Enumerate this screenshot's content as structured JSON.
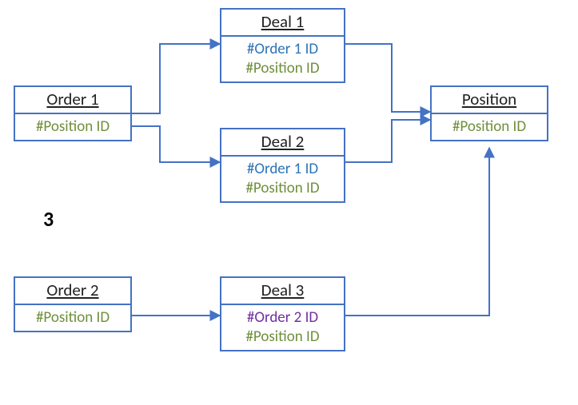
{
  "labels": {
    "sideB": "3"
  },
  "colors": {
    "border": "#4472c4",
    "orderA_ref": "#2e75b6",
    "orderB_ref": "#7030a0",
    "position_ref": "#6f8f3b",
    "title": "#222222"
  },
  "nodes": {
    "order1": {
      "title": "Order 1",
      "fields": [
        {
          "text": "#Position ID",
          "cls": "field-pos"
        }
      ]
    },
    "order2": {
      "title": "Order 2",
      "fields": [
        {
          "text": "#Position ID",
          "cls": "field-pos"
        }
      ]
    },
    "deal1": {
      "title": "Deal 1",
      "fields": [
        {
          "text": "#Order 1 ID",
          "cls": "field-orderA"
        },
        {
          "text": "#Position ID",
          "cls": "field-pos"
        }
      ]
    },
    "deal2": {
      "title": "Deal 2",
      "fields": [
        {
          "text": "#Order 1 ID",
          "cls": "field-orderA"
        },
        {
          "text": "#Position ID",
          "cls": "field-pos"
        }
      ]
    },
    "deal3": {
      "title": "Deal 3",
      "fields": [
        {
          "text": "#Order 2 ID",
          "cls": "field-orderB"
        },
        {
          "text": "#Position ID",
          "cls": "field-pos"
        }
      ]
    },
    "position": {
      "title": "Position",
      "fields": [
        {
          "text": "#Position ID",
          "cls": "field-pos"
        }
      ]
    }
  },
  "edges": [
    {
      "from": "order1",
      "to": "deal1"
    },
    {
      "from": "order1",
      "to": "deal2"
    },
    {
      "from": "deal1",
      "to": "position"
    },
    {
      "from": "deal2",
      "to": "position"
    },
    {
      "from": "order2",
      "to": "deal3"
    },
    {
      "from": "deal3",
      "to": "position"
    }
  ]
}
